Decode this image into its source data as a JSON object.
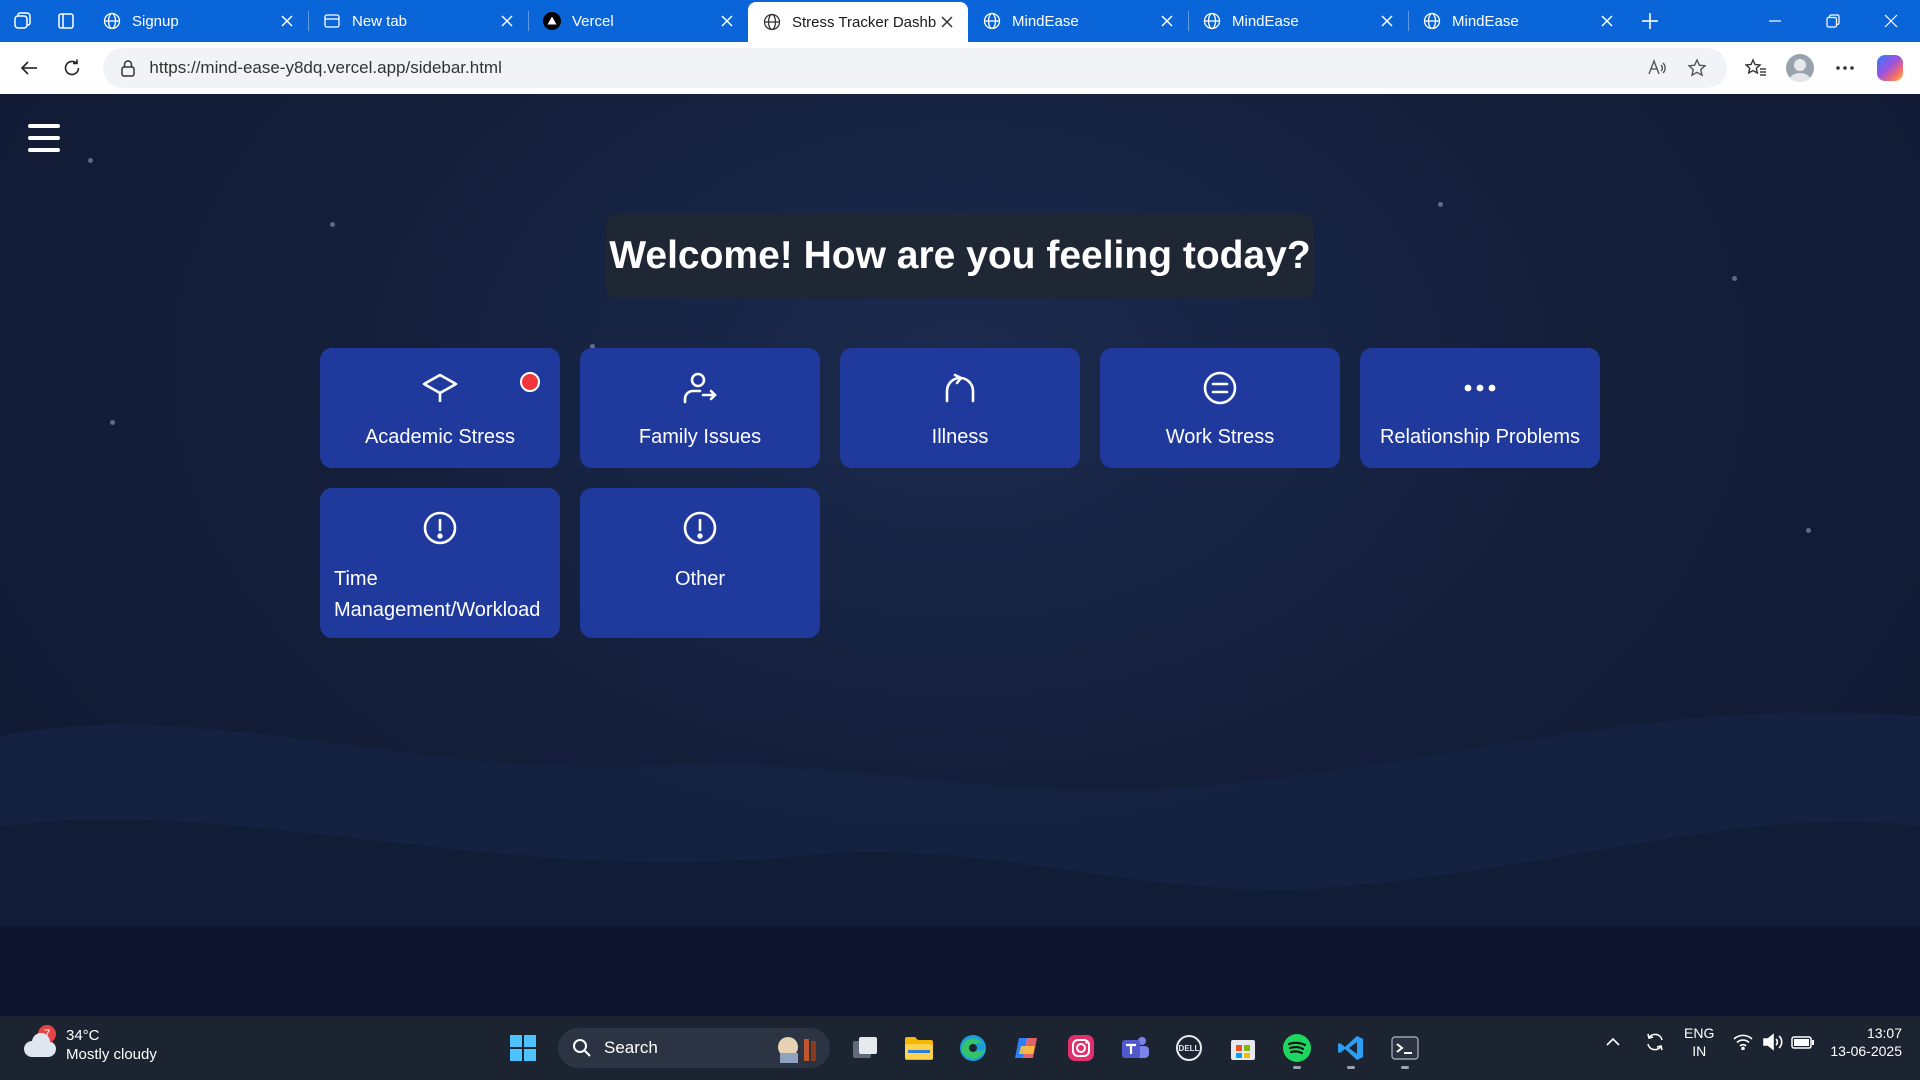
{
  "browser": {
    "tabs": [
      {
        "title": "Signup",
        "icon": "globe-icon"
      },
      {
        "title": "New tab",
        "icon": "newtab-icon"
      },
      {
        "title": "Vercel",
        "icon": "vercel-icon"
      },
      {
        "title": "Stress Tracker Dashbo",
        "icon": "globe-icon",
        "active": true
      },
      {
        "title": "MindEase",
        "icon": "globe-icon"
      },
      {
        "title": "MindEase",
        "icon": "globe-icon"
      },
      {
        "title": "MindEase",
        "icon": "globe-icon"
      }
    ],
    "url": "https://mind-ease-y8dq.vercel.app/sidebar.html",
    "accent_color": "#0a66d8"
  },
  "page": {
    "welcome_title": "Welcome! How are you feeling today?",
    "categories": [
      {
        "label": "Academic Stress",
        "icon": "graduation-cap-icon",
        "has_notification": true
      },
      {
        "label": "Family Issues",
        "icon": "family-icon"
      },
      {
        "label": "Illness",
        "icon": "stethoscope-icon"
      },
      {
        "label": "Work Stress",
        "icon": "briefcase-icon"
      },
      {
        "label": "Relationship Problems",
        "icon": "more-icon"
      },
      {
        "label": "Time Management/Workload",
        "label_line1": "Time",
        "label_line2": "Management/Workload",
        "icon": "alert-icon"
      },
      {
        "label": "Other",
        "icon": "alert-icon"
      }
    ],
    "card_color": "#1f3a9c",
    "notification_color": "#f0363d"
  },
  "taskbar": {
    "weather": {
      "temp": "34°C",
      "condition": "Mostly cloudy",
      "badge": "7"
    },
    "search_label": "Search",
    "language": {
      "line1": "ENG",
      "line2": "IN"
    },
    "clock": {
      "time": "13:07",
      "date": "13-06-2025"
    }
  }
}
